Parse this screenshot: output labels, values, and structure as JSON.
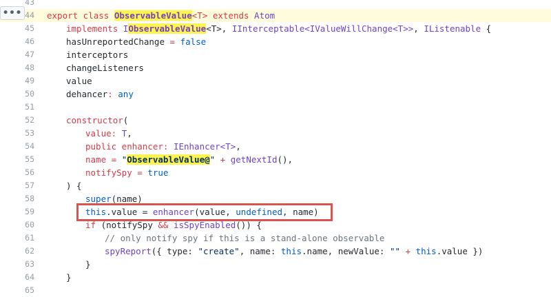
{
  "toolbar": {
    "more_actions": "•••"
  },
  "code_lines": [
    {
      "num": "43"
    },
    {
      "num": "44"
    },
    {
      "num": "45"
    },
    {
      "num": "46"
    },
    {
      "num": "47"
    },
    {
      "num": "48"
    },
    {
      "num": "49"
    },
    {
      "num": "50"
    },
    {
      "num": "51"
    },
    {
      "num": "52"
    },
    {
      "num": "53"
    },
    {
      "num": "54"
    },
    {
      "num": "55"
    },
    {
      "num": "56"
    },
    {
      "num": "57"
    },
    {
      "num": "58"
    },
    {
      "num": "59"
    },
    {
      "num": "60"
    },
    {
      "num": "61"
    },
    {
      "num": "62"
    },
    {
      "num": "63"
    },
    {
      "num": "64"
    },
    {
      "num": "65"
    }
  ],
  "tokens": {
    "l44": [
      "export class ",
      "ObservableValue",
      "<T> ",
      "extends",
      " Atom"
    ],
    "l45": [
      "implements ",
      "I",
      "ObservableValue",
      "<T>, ",
      "IInterceptable<IValueWillChange<T>>",
      ", ",
      "IListenable",
      " {"
    ],
    "l46": [
      "hasUnreportedChange",
      " = ",
      "false"
    ],
    "l47": [
      "interceptors"
    ],
    "l48": [
      "changeListeners"
    ],
    "l49": [
      "value"
    ],
    "l50": [
      "dehancer",
      ": ",
      "any"
    ],
    "l52": [
      "constructor",
      "("
    ],
    "l53": [
      "value",
      ": ",
      "T",
      ","
    ],
    "l54": [
      "public",
      " enhancer",
      ": ",
      "IEnhancer<T>",
      ","
    ],
    "l55": [
      "name",
      " = ",
      "\"",
      "ObservableValue@",
      "\"",
      " + ",
      "getNextId",
      "(),"
    ],
    "l56": [
      "notifySpy",
      " = ",
      "true"
    ],
    "l57": [
      ") {"
    ],
    "l58": [
      "super",
      "(name)"
    ],
    "l59": [
      "this",
      ".value = ",
      "enhancer",
      "(value, ",
      "undefined",
      ", name)"
    ],
    "l60": [
      "if",
      " (notifySpy ",
      "&&",
      " ",
      "isSpyEnabled",
      "()) {"
    ],
    "l61": [
      "// only notify spy if this is a stand-alone observable"
    ],
    "l62": [
      "spyReport",
      "({ type: ",
      "\"create\"",
      ", name: ",
      "this",
      ".name, newValue: ",
      "\"\"",
      " + ",
      "this",
      ".value })"
    ],
    "l63": [
      "}"
    ],
    "l64": [
      "}"
    ]
  }
}
